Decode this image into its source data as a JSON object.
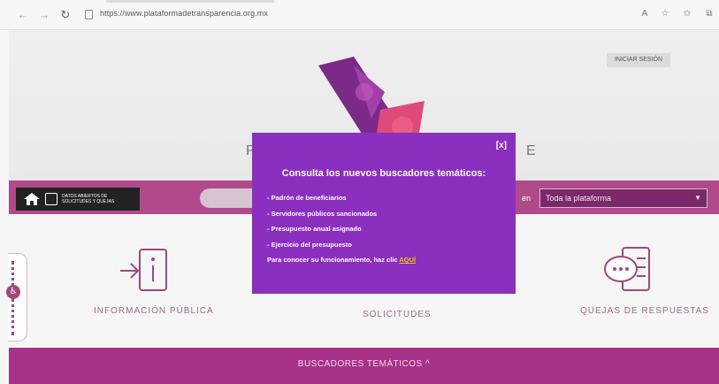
{
  "browser": {
    "url": "https://www.plataformadetransparencia.org.mx",
    "back_icon": "back-arrow-icon",
    "forward_icon": "forward-arrow-icon",
    "reload_icon": "reload-icon",
    "read_aloud_icon": "read-aloud-icon",
    "favorites_add_icon": "favorites-add-icon",
    "favorites_icon": "favorites-icon",
    "collections_icon": "collections-icon"
  },
  "header": {
    "login_label": "INICIAR SESIÓN",
    "p_letter": "P",
    "e_letter": "E"
  },
  "searchbar": {
    "datos_label": "DATOS ABIERTOS DE SOLICITUDES Y QUEJAS",
    "en_label": "en",
    "scope_selected": "Toda la plataforma"
  },
  "sections": {
    "info_label": "INFORMACIÓN PÚBLICA",
    "solicitudes_label": "SOLICITUDES",
    "quejas_label": "QUEJAS DE RESPUESTAS"
  },
  "bottom": {
    "buscadores_label": "BUSCADORES TEMÁTICOS ^"
  },
  "modal": {
    "close_label": "[x]",
    "title": "Consulta los nuevos buscadores temáticos:",
    "items": [
      "- Padrón de beneficiarios",
      "- Servidores públicos sancionados",
      "- Presupuesto anual asignado",
      "- Ejercicio del presupuesto"
    ],
    "cta_text": "Para conocer su funcionamiento, haz clic ",
    "cta_link": "AQUÍ"
  },
  "colors": {
    "magenta": "#b14a8a",
    "modal_purple": "#8a2fc0",
    "link_yellow": "#f5c400"
  }
}
